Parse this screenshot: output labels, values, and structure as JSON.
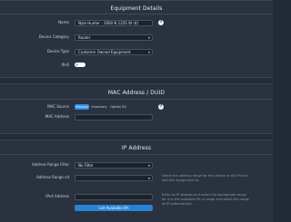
{
  "equipment": {
    "title": "Equipment Details",
    "name_label": "Name",
    "name_value": "Nyle Hunter - 2000 N 1250 W (4)",
    "category_label": "Device Category",
    "category_value": "Router",
    "type_label": "Device Type",
    "type_value": "Customer Owned Equipment",
    "ipv6_label": "IPv6"
  },
  "mac": {
    "title": "MAC Address / DUID",
    "source_label": "MAC Source",
    "source_options": [
      "Manual",
      "Inventory",
      "Option 82"
    ],
    "address_label": "MAC Address"
  },
  "ip": {
    "title": "IP Address",
    "range_filter_label": "Address Range Filter",
    "range_filter_value": "No Filter",
    "range_v4_label": "Address Range v4",
    "range_note": "Select the address range for this device or the IPv4 to add this assignment to.",
    "ipv4_label": "IPv4 Address",
    "ipv4_note": "Enter an IP address and select the appropriate range for it or the available IPs in range and select the range as IP automatically.",
    "list_button": "List Available IPs"
  },
  "icons": {
    "help": "?",
    "dropdown": "▾"
  }
}
